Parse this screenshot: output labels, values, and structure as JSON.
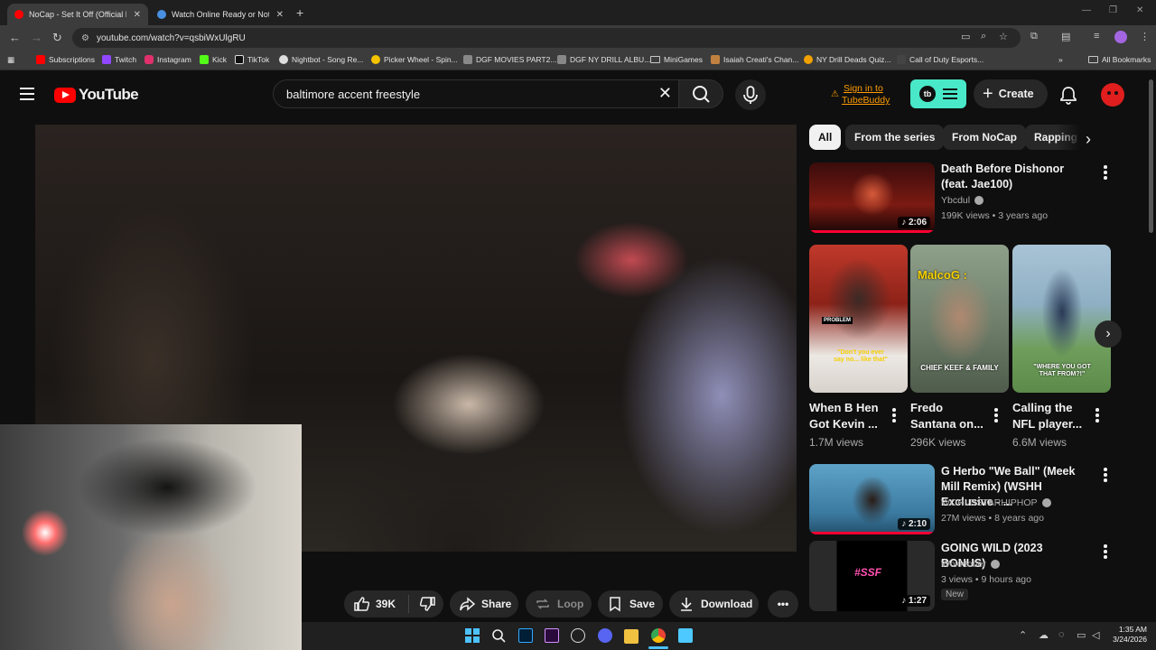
{
  "browser": {
    "tabs": [
      {
        "title": "NoCap - Set It Off (Official Mus",
        "active": true,
        "favicon_color": "#ff0000"
      },
      {
        "title": "Watch Online Ready or Not 2: H",
        "active": false,
        "favicon_color": "#4a90e2"
      }
    ],
    "url": "youtube.com/watch?v=qsbiWxUlgRU",
    "bookmarks": [
      {
        "label": "Subscriptions",
        "color": "#ff0000"
      },
      {
        "label": "Twitch",
        "color": "#9146ff"
      },
      {
        "label": "Instagram",
        "color": "#e1306c"
      },
      {
        "label": "Kick",
        "color": "#53fc18"
      },
      {
        "label": "TikTok",
        "color": "#ffffff"
      },
      {
        "label": "Nightbot - Song Re...",
        "color": "#dddddd"
      },
      {
        "label": "Picker Wheel - Spin...",
        "color": "#f5c400"
      },
      {
        "label": "DGF MOVIES PART2...",
        "color": "#888888"
      },
      {
        "label": "DGF NY DRILL ALBU...",
        "color": "#888888"
      },
      {
        "label": "MiniGames",
        "color": "folder"
      },
      {
        "label": "Isaiah Creati's Chan...",
        "color": "#c08040"
      },
      {
        "label": "NY Drill Deads Quiz...",
        "color": "#f0a000"
      },
      {
        "label": "Call of Duty Esports...",
        "color": "#dddddd"
      }
    ],
    "all_bookmarks": "All Bookmarks"
  },
  "youtube": {
    "logo_text": "YouTube",
    "search_value": "baltimore accent freestyle",
    "tubebuddy_signin": [
      "Sign in to",
      "TubeBuddy"
    ],
    "tubebuddy_logo": "tb",
    "create_label": "Create",
    "accent_color": "#ff0000"
  },
  "actions": {
    "likes": "39K",
    "share": "Share",
    "loop": "Loop",
    "save": "Save",
    "download": "Download"
  },
  "chips": [
    "All",
    "From the series",
    "From NoCap",
    "Rapping"
  ],
  "recommendations": [
    {
      "title": "Death Before Dishonor (feat. Jae100)",
      "channel": "Ybcdul",
      "verified": true,
      "meta": "199K views • 3 years ago",
      "duration": "2:06",
      "music": true,
      "progress": 1.0
    },
    {
      "title": "G Herbo \"We Ball\" (Meek Mill Remix) (WSHH Exclusive - ...",
      "channel": "WORLDSTARHIPHOP",
      "verified": true,
      "meta": "27M views • 8 years ago",
      "duration": "2:10",
      "music": true,
      "progress": 1.0
    },
    {
      "title": "GOING WILD (2023 BONUS)",
      "channel": "Wokktober",
      "verified": true,
      "meta": "3 views • 9 hours ago",
      "duration": "1:27",
      "music": true,
      "badge": "New"
    }
  ],
  "shorts": [
    {
      "title": "When B Hen Got Kevin ...",
      "views": "1.7M views",
      "overlay": "\"Don't you ever say no... like that\""
    },
    {
      "title": "Fredo Santana on...",
      "views": "296K views",
      "overlay_top": "MalcoG :",
      "overlay": "CHIEF KEEF & FAMILY"
    },
    {
      "title": "Calling the NFL player...",
      "views": "6.6M views",
      "overlay": "\"WHERE YOU GOT THAT FROM?!\""
    }
  ],
  "thumb_text": {
    "ssf": "#SSF",
    "problem": "PROBLEM"
  },
  "clock": {
    "time": "1:35 AM",
    "date": "3/24/2026"
  }
}
